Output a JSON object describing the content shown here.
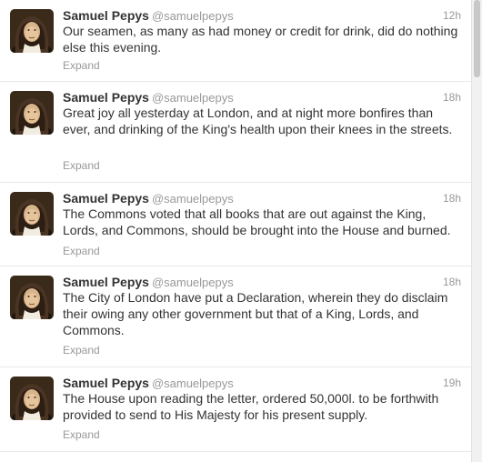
{
  "tweets": [
    {
      "name": "Samuel Pepys",
      "handle": "@samuelpepys",
      "time": "12h",
      "text": "Our seamen, as many as had money or credit for drink, did do nothing else this evening.",
      "expand": "Expand"
    },
    {
      "name": "Samuel Pepys",
      "handle": "@samuelpepys",
      "time": "18h",
      "text": "Great joy all yesterday at London, and at night more bonfires than ever, and drinking of the King's health upon their knees in the streets.",
      "expand": "Expand"
    },
    {
      "name": "Samuel Pepys",
      "handle": "@samuelpepys",
      "time": "18h",
      "text": "The Commons voted that all books that are out against the King, Lords, and Commons, should be brought into the House and burned.",
      "expand": "Expand"
    },
    {
      "name": "Samuel Pepys",
      "handle": "@samuelpepys",
      "time": "18h",
      "text": "The City of London have put a Declaration, wherein they do disclaim their owing any other government but that of a King, Lords, and Commons.",
      "expand": "Expand"
    },
    {
      "name": "Samuel Pepys",
      "handle": "@samuelpepys",
      "time": "19h",
      "text": "The House upon reading the letter, ordered 50,000l. to be forthwith provided to send to His Majesty for his present supply.",
      "expand": "Expand"
    }
  ],
  "avatar_icon": "portrait-avatar-icon",
  "colors": {
    "name": "#333333",
    "meta": "#999999",
    "divider": "#e8e8e8"
  }
}
